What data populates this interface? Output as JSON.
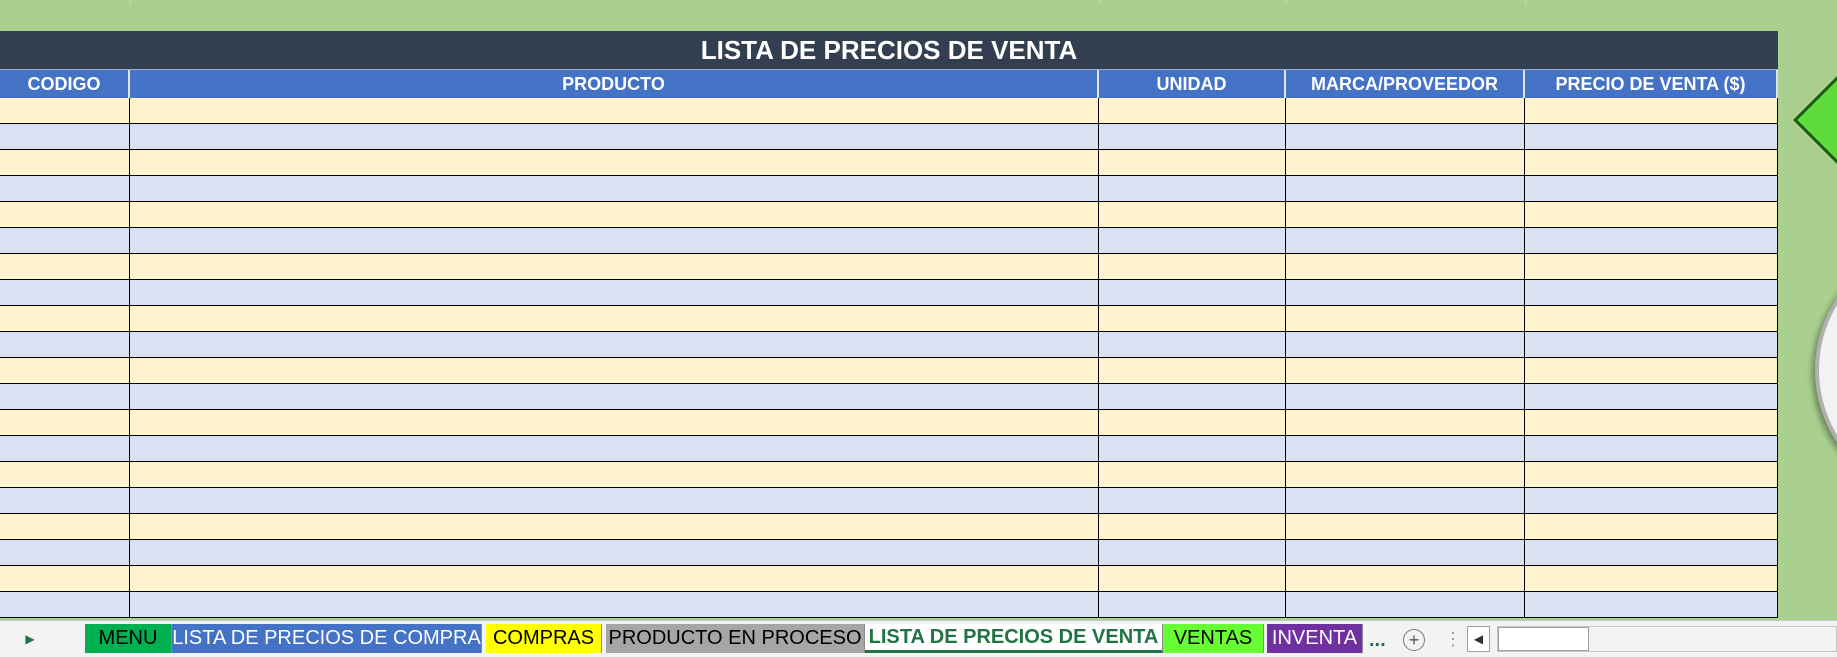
{
  "table": {
    "title": "LISTA DE PRECIOS DE VENTA",
    "headers": [
      "CODIGO",
      "PRODUCTO",
      "UNIDAD",
      "MARCA/PROVEEDOR",
      "PRECIO DE VENTA ($)"
    ],
    "row_count": 20,
    "row_colors": {
      "odd": "#fff2cc",
      "even": "#d9e1f2"
    },
    "header_color": "#4472c4",
    "title_color": "#333f50"
  },
  "sheet_background": "#a9d08e",
  "tabs": [
    {
      "label": "MENU",
      "bg": "#00b050",
      "fg": "#000000"
    },
    {
      "label": "LISTA DE PRECIOS DE COMPRA",
      "bg": "#4472c4",
      "fg": "#ffffff"
    },
    {
      "label": "COMPRAS",
      "bg": "#ffff00",
      "fg": "#000000"
    },
    {
      "label": "PRODUCTO EN PROCESO",
      "bg": "#a6a6a6",
      "fg": "#000000"
    },
    {
      "label": "LISTA DE PRECIOS DE VENTA",
      "bg": "#ffffff",
      "fg": "#217346",
      "active": true
    },
    {
      "label": "VENTAS",
      "bg": "#66ff33",
      "fg": "#000000"
    },
    {
      "label": "INVENTA",
      "bg": "#7030a0",
      "fg": "#ffffff"
    }
  ],
  "tab_overflow": "...",
  "icons": {
    "nav_right": "play-right-icon",
    "add_sheet": "plus-circle-icon",
    "scroll_left": "scroll-left-arrow-icon"
  }
}
